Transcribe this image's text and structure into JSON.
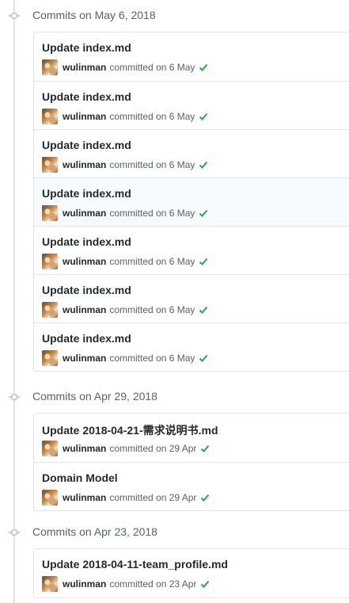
{
  "groups": [
    {
      "title": "Commits on May 6, 2018",
      "commits": [
        {
          "message": "Update index.md",
          "author": "wulinman",
          "committed": "committed on 6 May",
          "highlight": false
        },
        {
          "message": "Update index.md",
          "author": "wulinman",
          "committed": "committed on 6 May",
          "highlight": false
        },
        {
          "message": "Update index.md",
          "author": "wulinman",
          "committed": "committed on 6 May",
          "highlight": false
        },
        {
          "message": "Update index.md",
          "author": "wulinman",
          "committed": "committed on 6 May",
          "highlight": true
        },
        {
          "message": "Update index.md",
          "author": "wulinman",
          "committed": "committed on 6 May",
          "highlight": false
        },
        {
          "message": "Update index.md",
          "author": "wulinman",
          "committed": "committed on 6 May",
          "highlight": false
        },
        {
          "message": "Update index.md",
          "author": "wulinman",
          "committed": "committed on 6 May",
          "highlight": false
        }
      ]
    },
    {
      "title": "Commits on Apr 29, 2018",
      "commits": [
        {
          "message": "Update 2018-04-21-需求说明书.md",
          "author": "wulinman",
          "committed": "committed on 29 Apr",
          "highlight": false
        },
        {
          "message": "Domain Model",
          "author": "wulinman",
          "committed": "committed on 29 Apr",
          "highlight": false
        }
      ]
    },
    {
      "title": "Commits on Apr 23, 2018",
      "commits": [
        {
          "message": "Update 2018-04-11-team_profile.md",
          "author": "wulinman",
          "committed": "committed on 23 Apr",
          "highlight": false
        }
      ]
    }
  ],
  "colors": {
    "check": "#28a745",
    "highlight_row": "#f6fbff",
    "border": "#e1e4e8"
  },
  "icons": {
    "group": "git-commit-icon",
    "status": "check-icon",
    "avatar": "avatar"
  }
}
